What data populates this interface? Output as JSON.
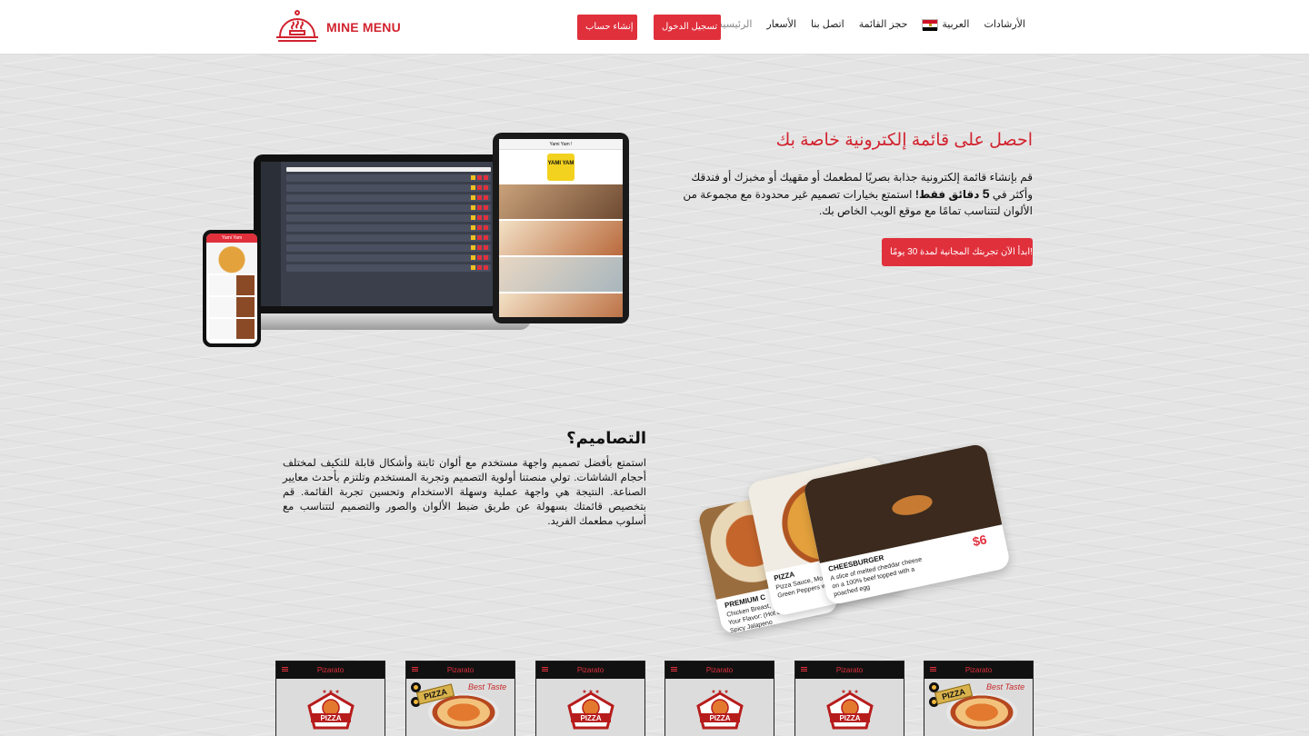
{
  "brand": {
    "name": "MINE MENU",
    "accent": "#d2232f"
  },
  "nav": {
    "home": "الرئيسية",
    "prices": "الأسعار",
    "contact": "اتصل بنا",
    "book_menu": "حجز القائمة",
    "language": "العربية",
    "guides": "الأرشادات",
    "login": "تسجيل الدخول",
    "signup": "إنشاء حساب"
  },
  "hero": {
    "title": "احصل على قائمة إلكترونية خاصة بك",
    "desc_part1": "قم بإنشاء قائمة إلكترونية جذابة بصريًا لمطعمك أو مقهيك أو مخبزك أو فندقك وأكثر في",
    "desc_num": "5",
    "desc_bold": "دقائق فقط!",
    "desc_part2": "استمتع بخيارات تصميم غير محدودة مع مجموعة من الألوان لتتناسب تمامًا مع موقع الويب الخاص بك.",
    "cta": "ابدأ الآن تجربتك المجانية لمدة 30 يومًا!"
  },
  "devices": {
    "phone_title": "Yami Yam",
    "tablet_title": "Yami Yam !",
    "tablet_logo": "YAMI YAM"
  },
  "designs": {
    "title": "التصاميم؟",
    "desc": "استمتع بأفضل تصميم واجهة مستخدم مع ألوان ثابتة وأشكال قابلة للتكيف لمختلف أحجام الشاشات. تولي منصتنا أولوية التصميم وتجربة المستخدم وتلتزم بأحدث معايير الصناعة. النتيجة هي واجهة عملية وسهلة الاستخدام وتحسين تجربة القائمة. قم بتخصيص قائمتك بسهولة عن طريق ضبط الألوان والصور والتصميم لتتناسب مع أسلوب مطعمك الفريد."
  },
  "food_cards": [
    {
      "title": "PREMIUM C",
      "desc": "Chicken Breast, Mozzarella, with Your Flavor: (Hot Buffalo Sauce or Spicy Jalapeno"
    },
    {
      "title": "PIZZA",
      "desc": "Pizza Sauce, Mozz Chicken Tikka, Oni Green Peppers wit Sauce"
    },
    {
      "title": "CHEESBURGER",
      "desc": "A slice of melted cheddar cheese on a 100% beef topped with a poached egg",
      "price": "$6"
    }
  ],
  "phone_previews": [
    {
      "header": "Pizarato",
      "style": "badge",
      "badge_text": "PIZZA"
    },
    {
      "header": "Pizarato",
      "style": "photo",
      "banner": "PIZZA",
      "script": "Best Taste"
    },
    {
      "header": "Pizarato",
      "style": "badge",
      "badge_text": "PIZZA"
    },
    {
      "header": "Pizarato",
      "style": "badge",
      "badge_text": "PIZZA"
    },
    {
      "header": "Pizarato",
      "style": "badge",
      "badge_text": "PIZZA"
    },
    {
      "header": "Pizarato",
      "style": "photo",
      "banner": "PIZZA",
      "script": "Best Taste"
    }
  ]
}
